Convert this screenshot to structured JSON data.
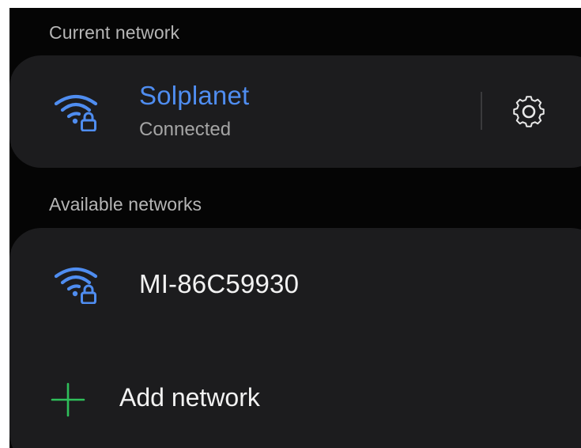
{
  "current_section": {
    "label": "Current network",
    "network": {
      "name": "Solplanet",
      "status": "Connected",
      "icon": "wifi-lock-icon",
      "settings_icon": "gear-icon"
    }
  },
  "available_section": {
    "label": "Available networks",
    "networks": [
      {
        "name": "MI-86C59930",
        "icon": "wifi-lock-icon"
      }
    ],
    "add_network": {
      "label": "Add network",
      "icon": "plus-icon"
    }
  },
  "colors": {
    "background": "#050505",
    "card": "#1c1c1e",
    "accent_blue": "#4f8df0",
    "add_green": "#2fbf5a",
    "section_label": "#b5b5b5",
    "status_text": "#a5a5a5",
    "primary_text": "#f2f2f2"
  }
}
